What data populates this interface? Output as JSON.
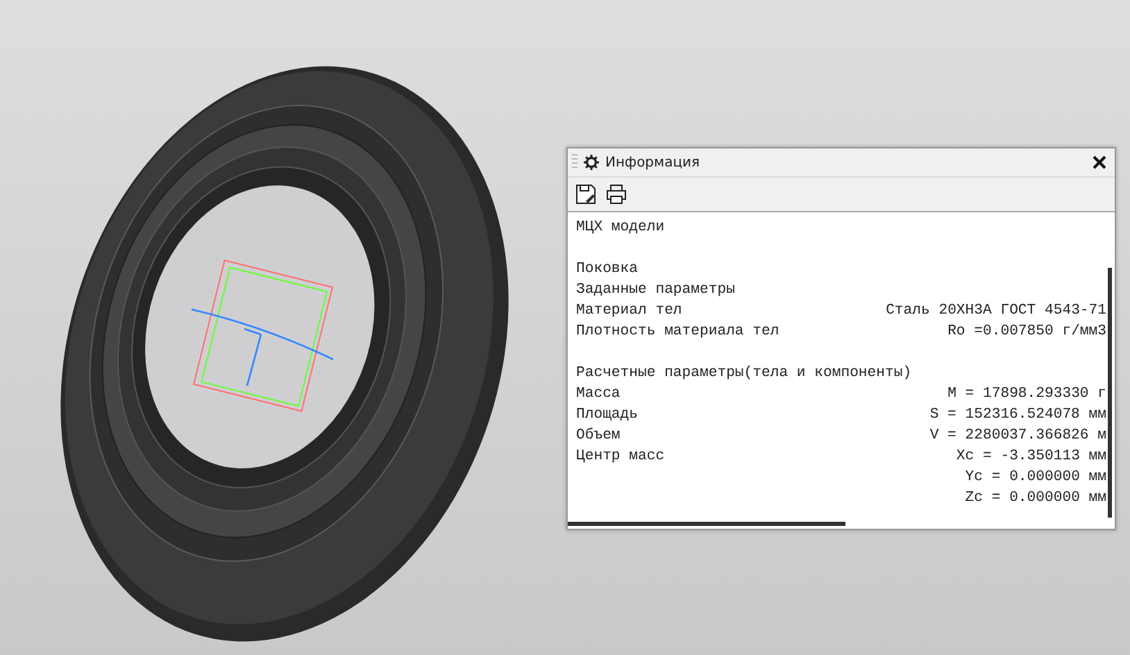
{
  "panel": {
    "title": "Информация",
    "lines": [
      {
        "label": "МЦХ модели"
      },
      {
        "kind": "blank"
      },
      {
        "label": "Поковка"
      },
      {
        "label": "Заданные параметры"
      },
      {
        "label": "Материал тел",
        "value": "Сталь 20ХН3А ГОСТ 4543-71"
      },
      {
        "label": "Плотность материала тел",
        "value": "Ro =0.007850 г/мм3"
      },
      {
        "kind": "blank"
      },
      {
        "label": "Расчетные параметры(тела и компоненты)"
      },
      {
        "label": "Масса",
        "value": "M = 17898.293330 г"
      },
      {
        "label": "Площадь",
        "value": "S = 152316.524078 мм"
      },
      {
        "label": "Объем",
        "value": "V = 2280037.366826 м"
      },
      {
        "label": "Центр масс",
        "value": "Xc = -3.350113 мм"
      },
      {
        "value": "Yc = 0.000000 мм"
      },
      {
        "value": "Zc = 0.000000 мм"
      }
    ]
  }
}
